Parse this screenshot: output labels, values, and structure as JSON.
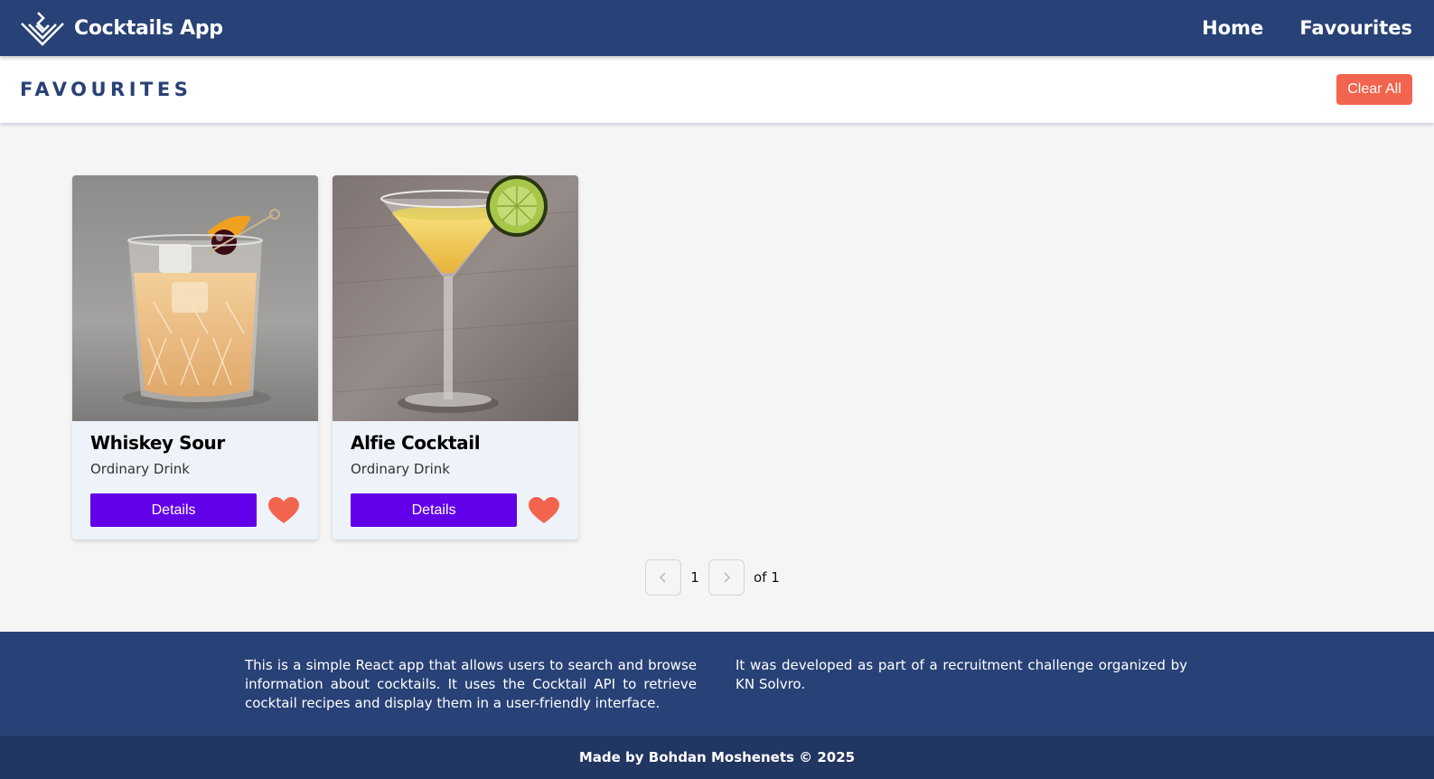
{
  "navbar": {
    "logo_icon": "cocktails-logo-icon",
    "title": "Cocktails App",
    "links": [
      "Home",
      "Favourites"
    ]
  },
  "subheader": {
    "title": "FAVOURITES",
    "clear_label": "Clear All"
  },
  "cards": [
    {
      "name": "Whiskey Sour",
      "category": "Ordinary Drink",
      "button": "Details",
      "favourite_icon": "heart-icon"
    },
    {
      "name": "Alfie Cocktail",
      "category": "Ordinary Drink",
      "button": "Details",
      "favourite_icon": "heart-icon"
    }
  ],
  "pagination": {
    "current": "1",
    "of_text": "of 1",
    "prev_icon": "chevron-left-icon",
    "next_icon": "chevron-right-icon"
  },
  "footer": {
    "left_text": "This is a simple React app that allows users to search and browse information about cocktails. It uses the Cocktail API to retrieve cocktail recipes and display them in a user-friendly interface.",
    "right_text": "It was developed as part of a recruitment challenge organized by KN Solvro.",
    "credit": "Made by Bohdan Moshenets © 2025"
  },
  "colors": {
    "nav_bg": "#284176",
    "accent_red": "#f2644d",
    "details_purple": "#6200ea",
    "footer_bottom": "#223662"
  }
}
